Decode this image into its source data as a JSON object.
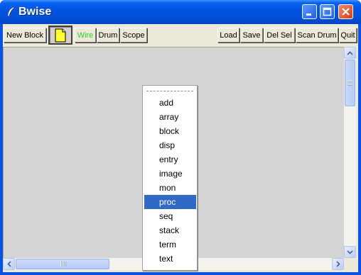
{
  "window": {
    "title": "Bwise"
  },
  "colors": {
    "accent": "#316ac5",
    "wire_label": "#33cc33"
  },
  "toolbar": {
    "new_block": "New Block",
    "wire": "Wire",
    "drum": "Drum",
    "scope": "Scope",
    "load": "Load",
    "save": "Save",
    "del_sel": "Del Sel",
    "scan_drum": "Scan Drum",
    "quit": "Quit"
  },
  "menu": {
    "selected": "proc",
    "items": [
      "add",
      "array",
      "block",
      "disp",
      "entry",
      "image",
      "mon",
      "proc",
      "seq",
      "stack",
      "term",
      "text"
    ]
  },
  "icons": {
    "title": "feather-icon",
    "page": "new-page-icon"
  }
}
